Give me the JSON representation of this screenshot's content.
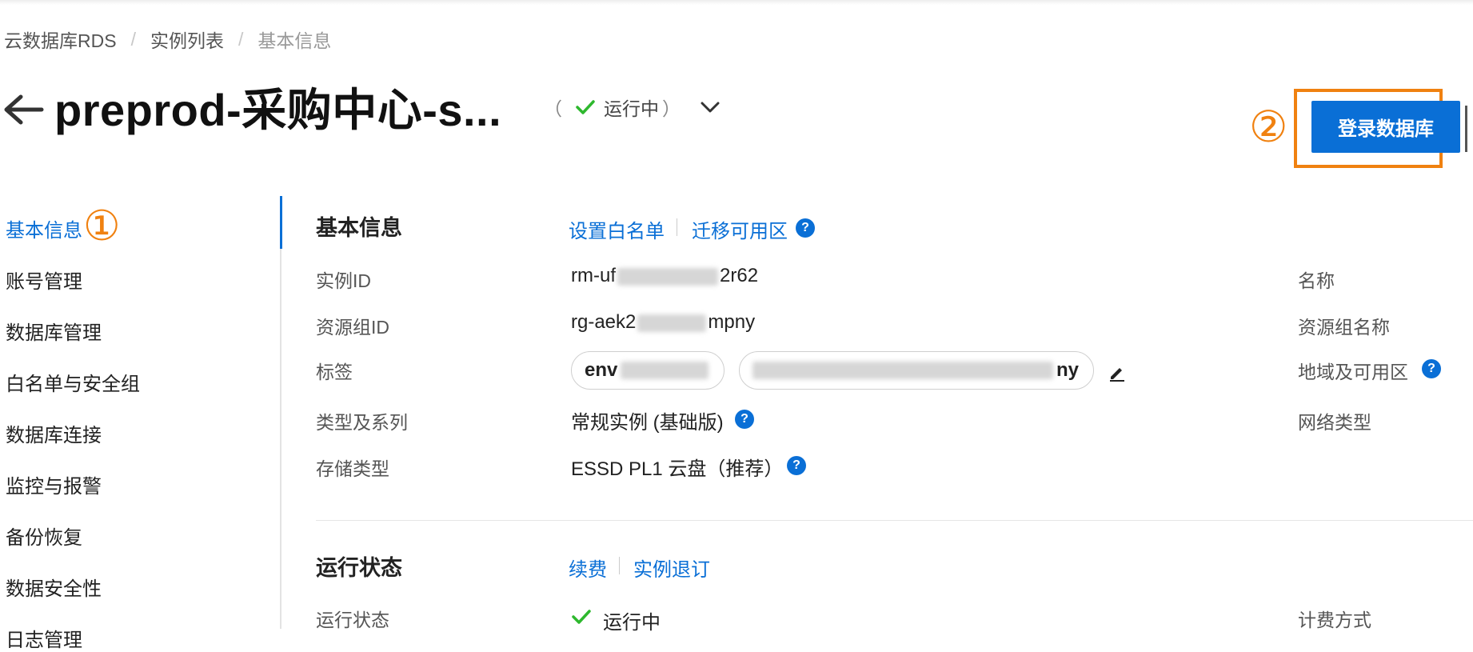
{
  "breadcrumb": {
    "item1": "云数据库RDS",
    "item2": "实例列表",
    "current": "基本信息",
    "separator": "/"
  },
  "header": {
    "title": "preprod-采购中心-s...",
    "status_text": "运行中",
    "paren_open": "（",
    "paren_close": "）",
    "login_button": "登录数据库"
  },
  "annotations": {
    "marker1": "①",
    "marker2": "②"
  },
  "nav": {
    "items": [
      "基本信息",
      "账号管理",
      "数据库管理",
      "白名单与安全组",
      "数据库连接",
      "监控与报警",
      "备份恢复",
      "数据安全性",
      "日志管理"
    ]
  },
  "basic_info": {
    "title": "基本信息",
    "link_whitelist": "设置白名单",
    "link_migrate": "迁移可用区",
    "rows": {
      "instance_id_label": "实例ID",
      "instance_id_prefix": "rm-uf",
      "instance_id_suffix": "2r62",
      "resource_group_label": "资源组ID",
      "resource_group_prefix": "rg-aek2",
      "resource_group_suffix": "mpny",
      "tags_label": "标签",
      "tag1_prefix": "env",
      "tag2_suffix": "ny",
      "type_label": "类型及系列",
      "type_value": "常规实例 (基础版)",
      "storage_label": "存储类型",
      "storage_value": "ESSD PL1 云盘（推荐）"
    },
    "right_labels": {
      "name": "名称",
      "rg_name": "资源组名称",
      "region": "地域及可用区",
      "network": "网络类型"
    }
  },
  "running_status": {
    "title": "运行状态",
    "link_renew": "续费",
    "link_unsubscribe": "实例退订",
    "status_label": "运行状态",
    "status_value": "运行中",
    "billing_label": "计费方式"
  },
  "colors": {
    "accent": "#0a6fd6",
    "annotation": "#f08110",
    "success": "#2eb82e"
  }
}
